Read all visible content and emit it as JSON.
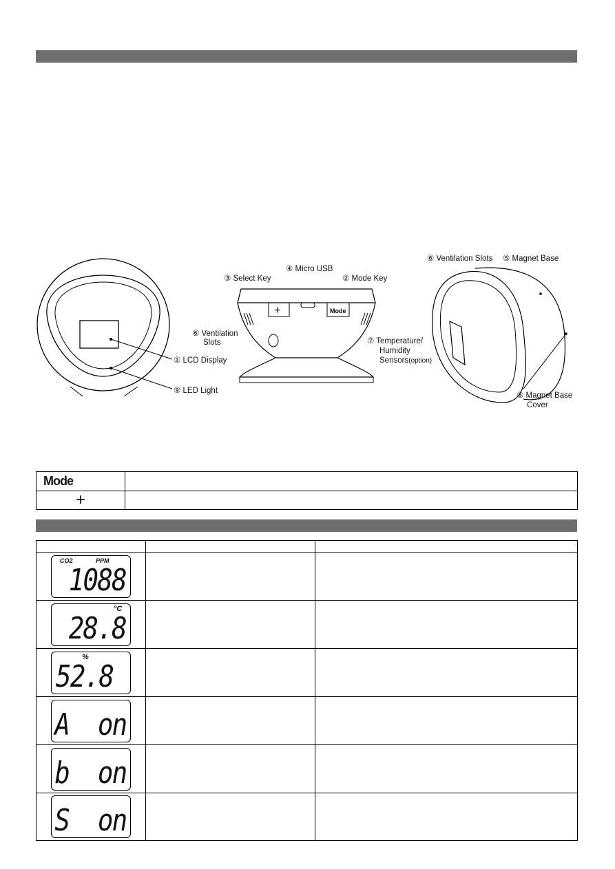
{
  "diagram": {
    "labels": {
      "lcd_display": "① LCD Display",
      "led_light": "⑨ LED Light",
      "select_key": "③ Select Key",
      "micro_usb": "④ Micro USB",
      "mode_key": "② Mode Key",
      "ventilation_slots_1": "⑥ Ventilation",
      "ventilation_slots_2": "Slots",
      "temp_sensor_1": "⑦ Temperature/",
      "temp_sensor_2": "Humidity",
      "temp_sensor_3": "Sensors",
      "temp_sensor_option": "(option)",
      "ventilation_slots_right": "⑥ Ventilation Slots",
      "magnet_base": "⑤ Magnet Base",
      "magnet_base_cover_1": "⑧ Magnet Base",
      "magnet_base_cover_2": "Cover"
    },
    "button_mode": "Mode"
  },
  "keys_table": {
    "rows": [
      {
        "key": "Mode",
        "description": ""
      },
      {
        "key": "+",
        "description": ""
      }
    ]
  },
  "display_table": {
    "rows": [
      {
        "top_left": "CO2",
        "top_right": "PPM",
        "value": "1088"
      },
      {
        "top_left": "",
        "top_right": "°C",
        "value": "28.8"
      },
      {
        "top_left": "%",
        "top_right": "",
        "value": "52.8"
      },
      {
        "top_left": "",
        "top_right": "",
        "value": "A  on"
      },
      {
        "top_left": "",
        "top_right": "",
        "value": "b  on"
      },
      {
        "top_left": "",
        "top_right": "",
        "value": "S  on"
      }
    ]
  }
}
